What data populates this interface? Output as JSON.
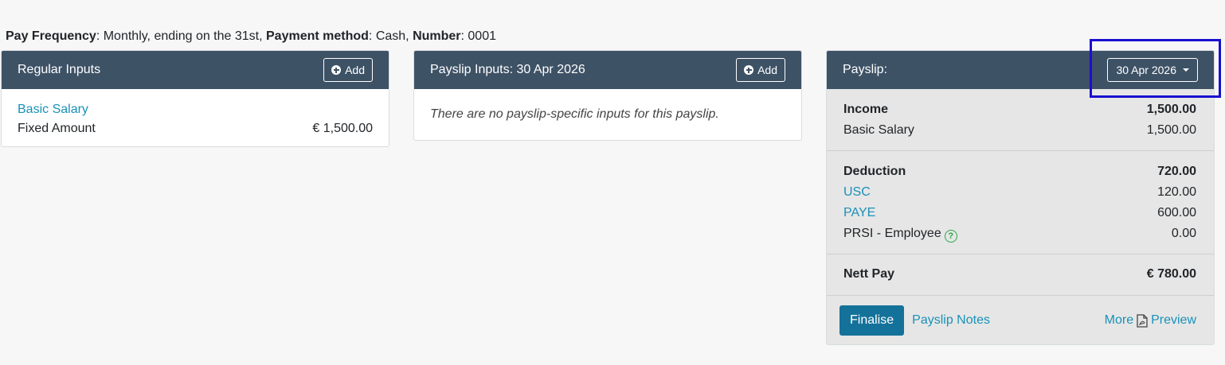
{
  "info": {
    "pay_frequency_label": "Pay Frequency",
    "pay_frequency_value": ": Monthly, ending on the 31st, ",
    "payment_method_label": "Payment method",
    "payment_method_value": ": Cash, ",
    "number_label": "Number",
    "number_value": ": 0001"
  },
  "regular_inputs": {
    "title": "Regular Inputs",
    "add_label": "Add",
    "item_name": "Basic Salary",
    "item_type": "Fixed Amount",
    "item_amount": "€ 1,500.00"
  },
  "payslip_inputs": {
    "title": "Payslip Inputs: 30 Apr 2026",
    "add_label": "Add",
    "empty_message": "There are no payslip-specific inputs for this payslip."
  },
  "payslip": {
    "title": "Payslip:",
    "date_selected": "30 Apr 2026",
    "income": {
      "label": "Income",
      "total": "1,500.00",
      "lines": [
        {
          "name": "Basic Salary",
          "amount": "1,500.00"
        }
      ]
    },
    "deduction": {
      "label": "Deduction",
      "total": "720.00",
      "lines": [
        {
          "name": "USC",
          "amount": "120.00"
        },
        {
          "name": "PAYE",
          "amount": "600.00"
        },
        {
          "name": "PRSI - Employee",
          "amount": "0.00"
        }
      ]
    },
    "nett": {
      "label": "Nett Pay",
      "amount": "€ 780.00"
    },
    "help_glyph": "?",
    "finalise_label": "Finalise",
    "notes_label": "Payslip Notes",
    "more_label": "More",
    "preview_label": "Preview",
    "link_color": "#1991b8",
    "header_color": "#3e5266",
    "highlight_color": "#1a0fd0"
  }
}
